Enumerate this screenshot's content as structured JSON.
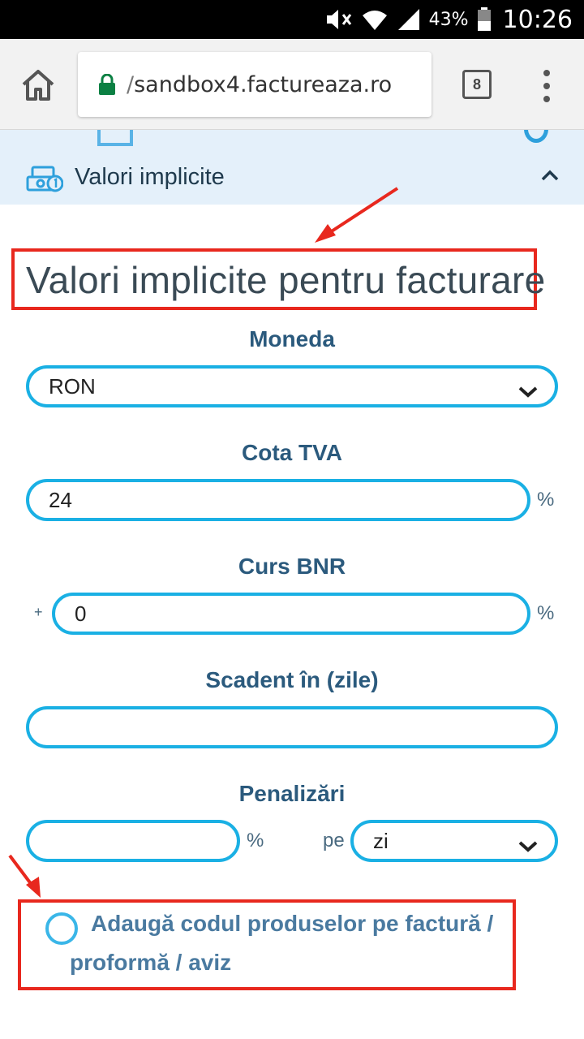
{
  "status_bar": {
    "battery_percent": "43%",
    "time": "10:26",
    "icons": [
      "mute-icon",
      "wifi-icon",
      "signal-icon",
      "battery-icon"
    ]
  },
  "browser": {
    "url_prefix": "/",
    "url": "sandbox4.factureaza.ro",
    "tab_count": "8",
    "icons": [
      "home-icon",
      "lock-icon",
      "tabs-icon",
      "overflow-menu-icon"
    ]
  },
  "accordion": {
    "title": "Valori implicite",
    "expanded": true,
    "icon": "money-icon"
  },
  "form": {
    "heading": "Valori implicite pentru facturare",
    "currency": {
      "label": "Moneda",
      "value": "RON",
      "options_selected": "RON"
    },
    "vat": {
      "label": "Cota TVA",
      "value": "24",
      "unit": "%"
    },
    "bnr": {
      "label": "Curs BNR",
      "prefix": "+",
      "value": "0",
      "unit": "%"
    },
    "due": {
      "label": "Scadent în (zile)",
      "value": ""
    },
    "penalty": {
      "label": "Penalizări",
      "value": "",
      "unit": "%",
      "per_label": "pe",
      "period": "zi"
    },
    "product_code_option": {
      "line1": "Adaugă codul produselor pe factură /",
      "line2": "proformă / aviz",
      "checked": false
    }
  },
  "colors": {
    "accent": "#1ab0e4",
    "label": "#2b5a7d",
    "callout": "#e8281e",
    "accordion_bg": "#e4f0fa"
  }
}
